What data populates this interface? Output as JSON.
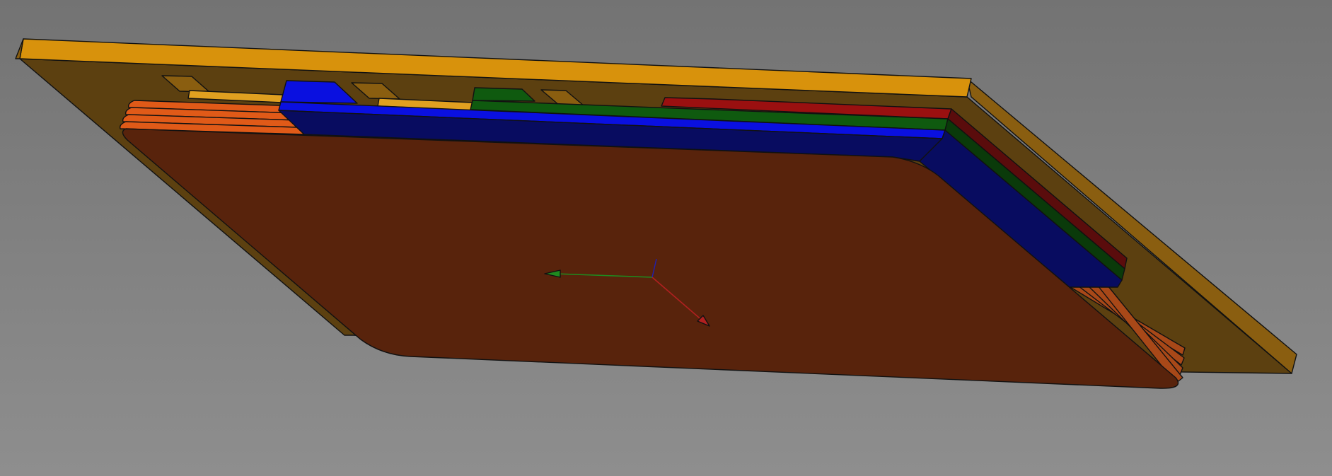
{
  "viewer": {
    "background_top": "#737373",
    "background_bottom": "#8e8e8e",
    "edge_color": "#111111"
  },
  "model": {
    "frame": {
      "top_color": "#d8920c",
      "side_color": "#8a5e10",
      "dark_color": "#5c4010"
    },
    "inner_tabs_color": "#e0a020",
    "orange_layers": {
      "color": "#e05a18",
      "side_color": "#a84818",
      "count": 4
    },
    "stacked_strips": [
      {
        "name": "red",
        "color": "#9a1010",
        "side_color": "#5a0c0c"
      },
      {
        "name": "green",
        "color": "#0f5a0f",
        "side_color": "#0a3a0a"
      },
      {
        "name": "blue",
        "color": "#0a10e0",
        "side_color": "#080c60"
      }
    ],
    "base_plate_color": "#58230c"
  },
  "triad": {
    "x_axis_color": "#b02020",
    "y_axis_color": "#1f8a1f",
    "z_axis_color": "#2020b0"
  }
}
